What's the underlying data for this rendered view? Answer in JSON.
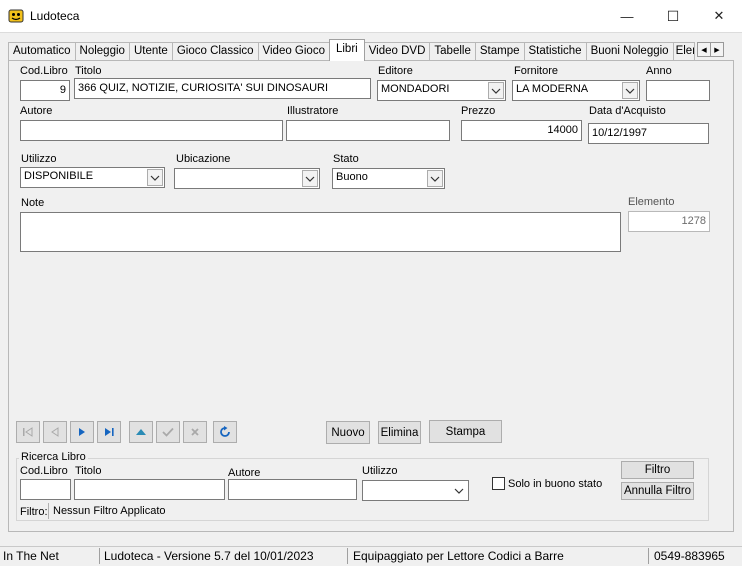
{
  "window": {
    "title": "Ludoteca",
    "minimize_glyph": "—",
    "maximize_glyph": "☐",
    "close_glyph": "✕"
  },
  "tabs": [
    {
      "label": "Automatico"
    },
    {
      "label": "Noleggio"
    },
    {
      "label": "Utente"
    },
    {
      "label": "Gioco Classico"
    },
    {
      "label": "Video Gioco"
    },
    {
      "label": "Libri",
      "active": true
    },
    {
      "label": "Video DVD"
    },
    {
      "label": "Tabelle"
    },
    {
      "label": "Stampe"
    },
    {
      "label": "Statistiche"
    },
    {
      "label": "Buoni Noleggio"
    },
    {
      "label": "Elem"
    }
  ],
  "form": {
    "cod_libro": {
      "label": "Cod.Libro",
      "value": "9"
    },
    "titolo": {
      "label": "Titolo",
      "value": "366 QUIZ, NOTIZIE, CURIOSITA' SUI DINOSAURI"
    },
    "editore": {
      "label": "Editore",
      "value": "MONDADORI"
    },
    "fornitore": {
      "label": "Fornitore",
      "value": "LA MODERNA"
    },
    "anno": {
      "label": "Anno",
      "value": ""
    },
    "autore": {
      "label": "Autore",
      "value": ""
    },
    "illustratore": {
      "label": "Illustratore",
      "value": ""
    },
    "prezzo": {
      "label": "Prezzo",
      "value": "14000"
    },
    "data_acquisto": {
      "label": "Data d'Acquisto",
      "value": "10/12/1997"
    },
    "utilizzo": {
      "label": "Utilizzo",
      "value": "DISPONIBILE"
    },
    "ubicazione": {
      "label": "Ubicazione",
      "value": ""
    },
    "stato": {
      "label": "Stato",
      "value": "Buono"
    },
    "note": {
      "label": "Note",
      "value": ""
    },
    "elemento": {
      "label": "Elemento",
      "value": "1278"
    }
  },
  "buttons": {
    "nuovo": "Nuovo",
    "elimina": "Elimina",
    "stampa": "Stampa"
  },
  "search": {
    "group_title": "Ricerca Libro",
    "cod_libro_label": "Cod.Libro",
    "titolo_label": "Titolo",
    "autore_label": "Autore",
    "utilizzo_label": "Utilizzo",
    "buono_stato_label": "Solo in buono stato",
    "filtro_button": "Filtro",
    "annulla_button": "Annulla Filtro",
    "filtro_label": "Filtro:",
    "filtro_value": "Nessun Filtro Applicato"
  },
  "status": {
    "company": "In The Net",
    "version": "Ludoteca - Versione 5.7 del 10/01/2023",
    "feature": "Equipaggiato per Lettore Codici a Barre",
    "phone": "0549-883965"
  },
  "colors": {
    "nav_blue": "#1565c0",
    "nav_disabled": "#a9a9a9",
    "nav_teal": "#2a8bb5"
  }
}
